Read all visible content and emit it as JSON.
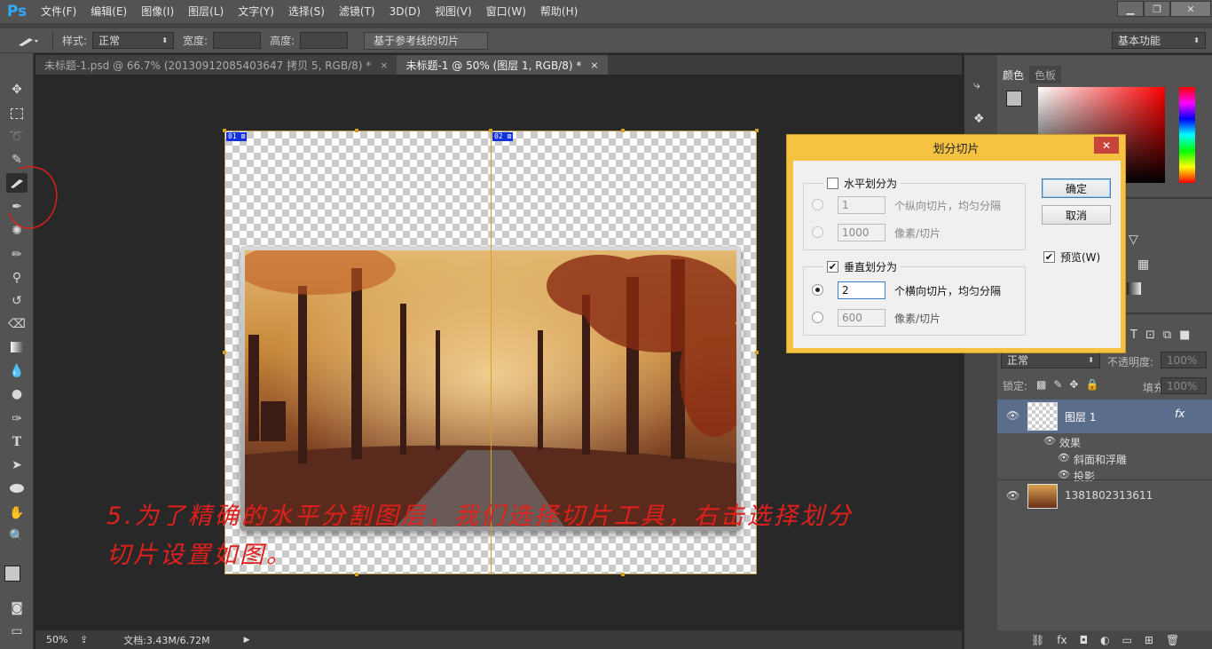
{
  "app": {
    "logo": "Ps"
  },
  "menu": [
    "文件(F)",
    "编辑(E)",
    "图像(I)",
    "图层(L)",
    "文字(Y)",
    "选择(S)",
    "滤镜(T)",
    "3D(D)",
    "视图(V)",
    "窗口(W)",
    "帮助(H)"
  ],
  "window_controls": {
    "minimize": "▁",
    "restore": "❐",
    "close": "✕"
  },
  "options": {
    "style_label": "样式:",
    "style_value": "正常",
    "width_label": "宽度:",
    "height_label": "高度:",
    "slice_btn": "基于参考线的切片",
    "workspace": "基本功能"
  },
  "tabs": [
    {
      "label": "未标题-1.psd @ 66.7% (20130912085403647 拷贝 5, RGB/8) *",
      "close": "×"
    },
    {
      "label": "未标题-1 @ 50% (图层 1, RGB/8) *",
      "close": "×"
    }
  ],
  "slices": [
    "01",
    "02"
  ],
  "annotation": {
    "line1": "5.为了精确的水平分割图层，我们选择切片工具，右击选择划分",
    "line2": "切片设置如图。"
  },
  "status": {
    "zoom": "50%",
    "doc": "文档:3.43M/6.72M"
  },
  "panels": {
    "color_tab": "颜色",
    "swatch_tab": "色板",
    "blend_mode": "正常",
    "opacity_label": "不透明度:",
    "opacity_value": "100%",
    "lock_label": "锁定:",
    "fill_label": "填充:",
    "fill_value": "100%",
    "layers": [
      {
        "name": "图层 1",
        "fx": "fx"
      },
      {
        "name": "效果"
      },
      {
        "name": "斜面和浮雕"
      },
      {
        "name": "投影"
      },
      {
        "name": "1381802313611"
      }
    ]
  },
  "dialog": {
    "title": "划分切片",
    "close": "✕",
    "horizontal": {
      "label": "水平划分为",
      "checked": false,
      "value1": "1",
      "label1": "个纵向切片，均匀分隔",
      "value2": "1000",
      "label2": "像素/切片"
    },
    "vertical": {
      "label": "垂直划分为",
      "checked": true,
      "value1": "2",
      "label1": "个横向切片，均匀分隔",
      "value2": "600",
      "label2": "像素/切片"
    },
    "ok": "确定",
    "cancel": "取消",
    "preview": "预览(W)",
    "preview_checked": true
  },
  "colors": {
    "accent": "#f5c242",
    "annotation": "#e0201c",
    "slice_line": "#d6a020"
  }
}
